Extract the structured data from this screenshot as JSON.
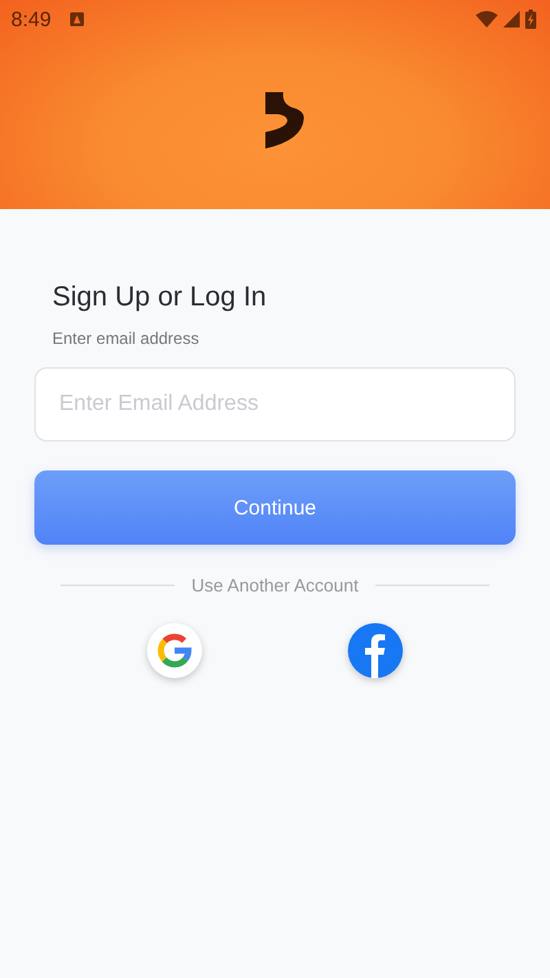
{
  "status_bar": {
    "time": "8:49"
  },
  "title": "Sign Up or Log In",
  "email_label": "Enter email address",
  "email_field": {
    "placeholder": "Enter Email Address"
  },
  "continue_button": {
    "label": "Continue"
  },
  "divider_text": "Use Another Account",
  "social_buttons": [
    {
      "kind": "google"
    },
    {
      "kind": "facebook"
    }
  ]
}
